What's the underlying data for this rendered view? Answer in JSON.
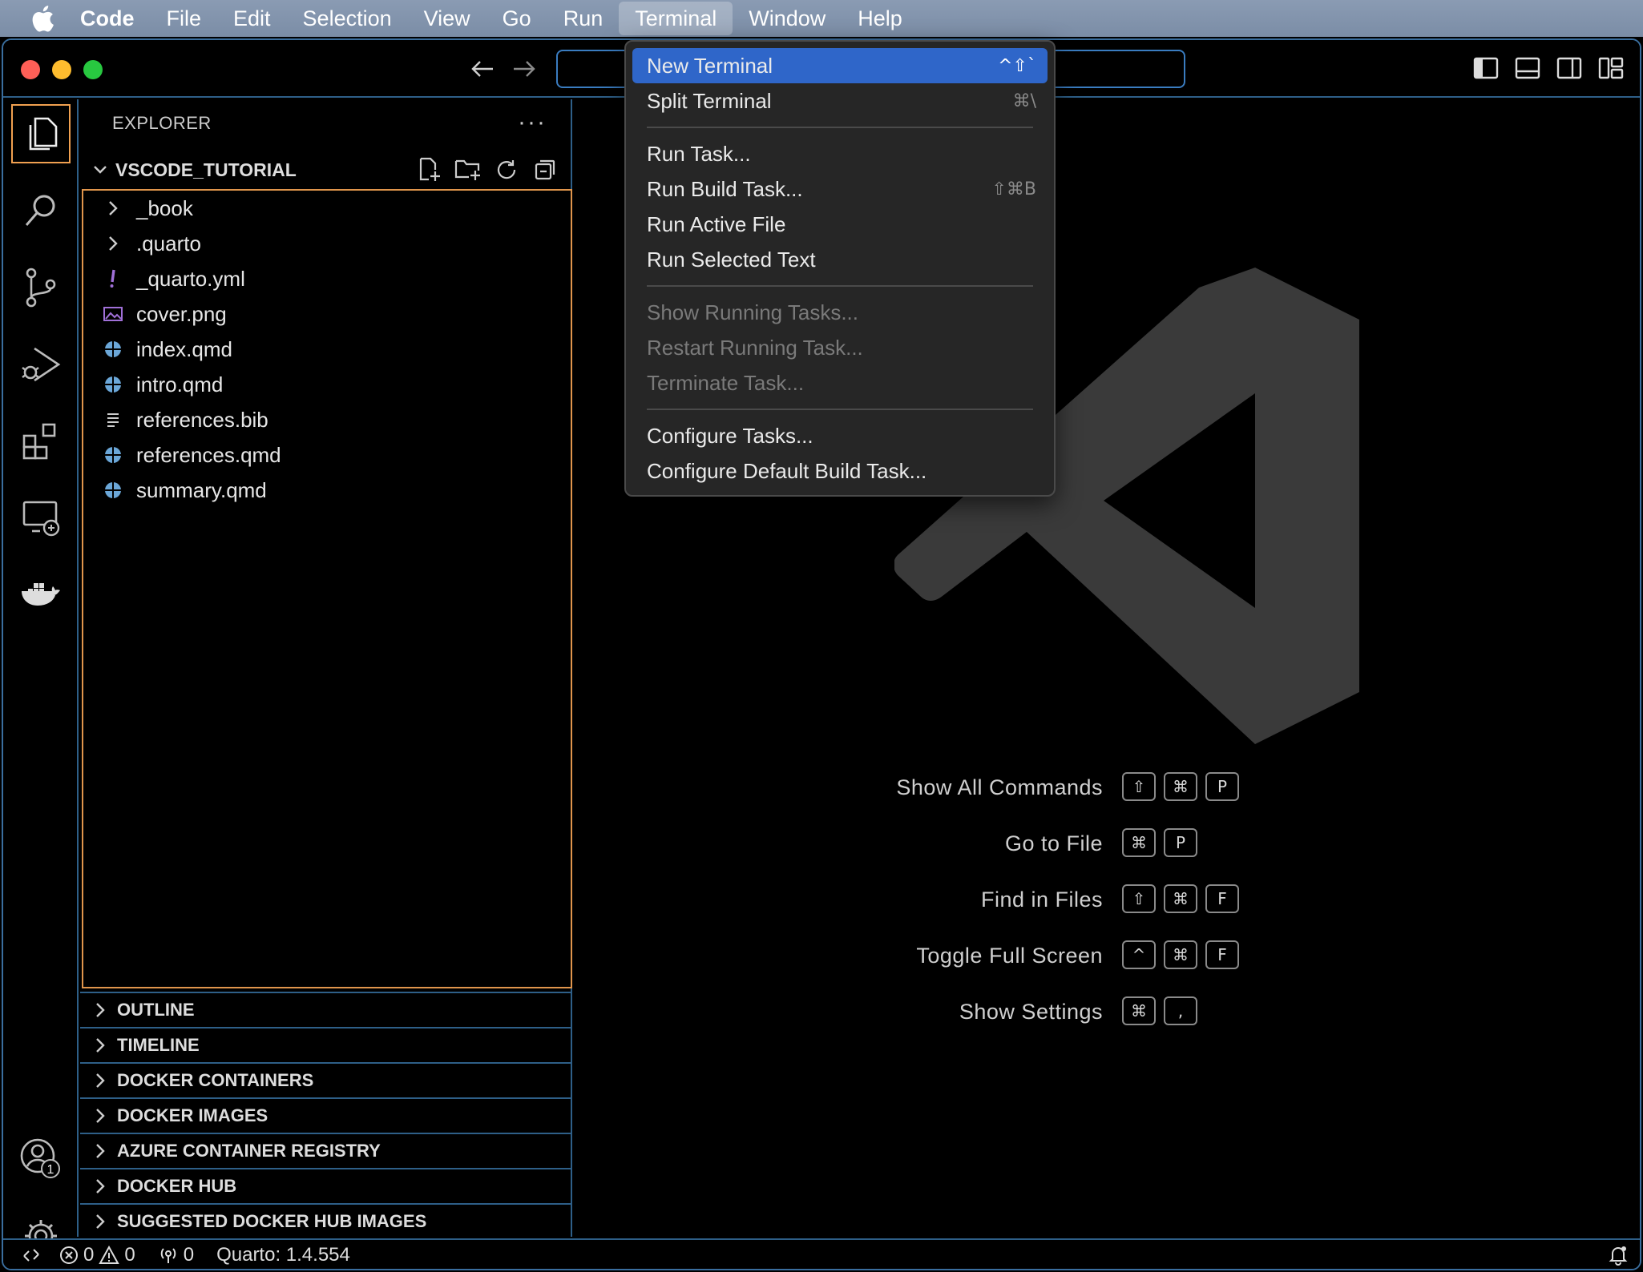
{
  "menubar": {
    "app": "Code",
    "items": [
      "File",
      "Edit",
      "Selection",
      "View",
      "Go",
      "Run",
      "Terminal",
      "Window",
      "Help"
    ],
    "active": "Terminal"
  },
  "sidebar": {
    "title": "EXPLORER",
    "more": "···",
    "folder": "VSCODE_TUTORIAL",
    "files": [
      {
        "name": "_book",
        "icon": "chevron-right-icon"
      },
      {
        "name": ".quarto",
        "icon": "chevron-right-icon"
      },
      {
        "name": "_quarto.yml",
        "icon": "yaml-icon"
      },
      {
        "name": "cover.png",
        "icon": "image-icon"
      },
      {
        "name": "index.qmd",
        "icon": "quarto-icon"
      },
      {
        "name": "intro.qmd",
        "icon": "quarto-icon"
      },
      {
        "name": "references.bib",
        "icon": "text-lines-icon"
      },
      {
        "name": "references.qmd",
        "icon": "quarto-icon"
      },
      {
        "name": "summary.qmd",
        "icon": "quarto-icon"
      }
    ],
    "sections": [
      "OUTLINE",
      "TIMELINE",
      "DOCKER CONTAINERS",
      "DOCKER IMAGES",
      "AZURE CONTAINER REGISTRY",
      "DOCKER HUB",
      "SUGGESTED DOCKER HUB IMAGES"
    ]
  },
  "terminal_menu": {
    "items": [
      {
        "label": "New Terminal",
        "shortcut": "^⇧`",
        "highlighted": true
      },
      {
        "label": "Split Terminal",
        "shortcut": "⌘\\"
      },
      {
        "sep": true
      },
      {
        "label": "Run Task..."
      },
      {
        "label": "Run Build Task...",
        "shortcut": "⇧⌘B"
      },
      {
        "label": "Run Active File"
      },
      {
        "label": "Run Selected Text"
      },
      {
        "sep": true
      },
      {
        "label": "Show Running Tasks...",
        "disabled": true
      },
      {
        "label": "Restart Running Task...",
        "disabled": true
      },
      {
        "label": "Terminate Task...",
        "disabled": true
      },
      {
        "sep": true
      },
      {
        "label": "Configure Tasks..."
      },
      {
        "label": "Configure Default Build Task..."
      }
    ]
  },
  "shortcuts": [
    {
      "label": "Show All Commands",
      "keys": [
        "⇧",
        "⌘",
        "P"
      ]
    },
    {
      "label": "Go to File",
      "keys": [
        "⌘",
        "P"
      ]
    },
    {
      "label": "Find in Files",
      "keys": [
        "⇧",
        "⌘",
        "F"
      ]
    },
    {
      "label": "Toggle Full Screen",
      "keys": [
        "^",
        "⌘",
        "F"
      ]
    },
    {
      "label": "Show Settings",
      "keys": [
        "⌘",
        ","
      ]
    }
  ],
  "statusbar": {
    "errors": "0",
    "warnings": "0",
    "ports": "0",
    "quarto": "Quarto: 1.4.554"
  },
  "accounts_badge": "1",
  "colors": {
    "accent": "#2f66c9",
    "border": "#2e5f88",
    "focus": "#e0954c"
  }
}
